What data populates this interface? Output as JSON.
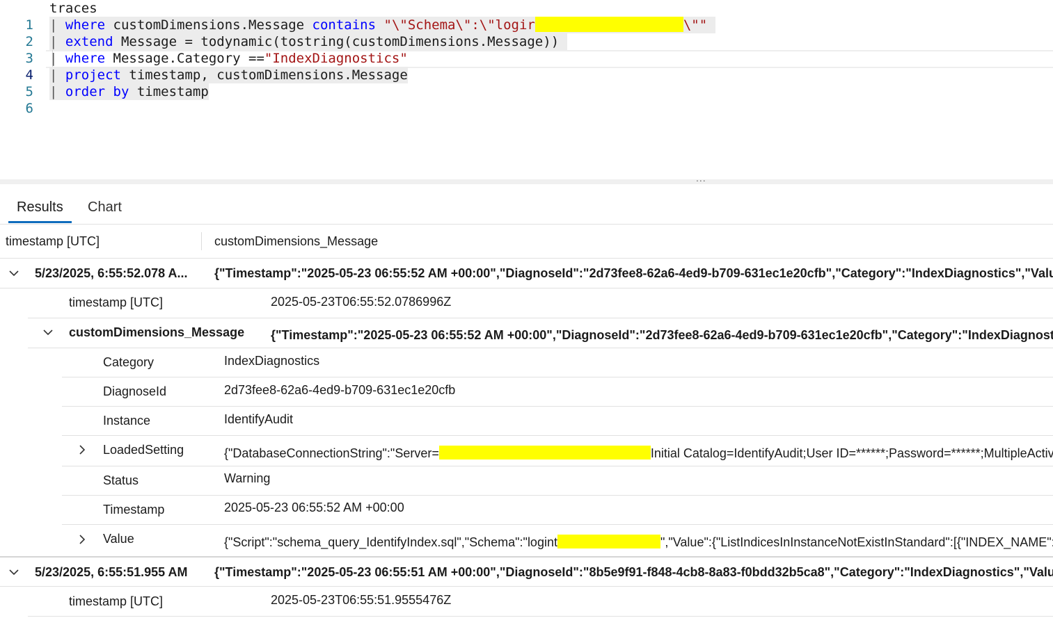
{
  "editor": {
    "lines": [
      {
        "num": "1",
        "text": "traces"
      },
      {
        "num": "2",
        "kw": "where",
        "t1": " customDimensions.Message ",
        "kw2": "contains",
        "str": "\"\\\"Schema\\\":\\\"logir",
        "str_end": "\\\"\""
      },
      {
        "num": "3",
        "kw": "extend",
        "t1": " Message = todynamic(tostring(customDimensions.Message))"
      },
      {
        "num": "4",
        "kw": "where",
        "t1": " Message.Category ==",
        "str": "\"IndexDiagnostics\""
      },
      {
        "num": "5",
        "kw": "project",
        "t1": " timestamp, customDimensions.Message"
      },
      {
        "num": "6",
        "kw": "order by",
        "t1": " timestamp"
      }
    ],
    "pipe": "|",
    "splitter_dots": "..."
  },
  "tabs": [
    {
      "label": "Results",
      "selected": true
    },
    {
      "label": "Chart",
      "selected": false
    }
  ],
  "grid": {
    "columns": [
      "timestamp [UTC]",
      "customDimensions_Message"
    ],
    "row1": {
      "timestamp": "5/23/2025, 6:55:52.078 A...",
      "message": "{\"Timestamp\":\"2025-05-23 06:55:52 AM +00:00\",\"DiagnoseId\":\"2d73fee8-62a6-4ed9-b709-631ec1e20cfb\",\"Category\":\"IndexDiagnostics\",\"Value\":{\"S",
      "detail_ts_label": "timestamp [UTC]",
      "detail_ts_value": "2025-05-23T06:55:52.0786996Z",
      "cd_label": "customDimensions_Message",
      "cd_value": "{\"Timestamp\":\"2025-05-23 06:55:52 AM +00:00\",\"DiagnoseId\":\"2d73fee8-62a6-4ed9-b709-631ec1e20cfb\",\"Category\":\"IndexDiagnostics\",\"",
      "props": [
        {
          "key": "Category",
          "value": "IndexDiagnostics"
        },
        {
          "key": "DiagnoseId",
          "value": "2d73fee8-62a6-4ed9-b709-631ec1e20cfb"
        },
        {
          "key": "Instance",
          "value": "IdentifyAudit"
        },
        {
          "key": "LoadedSetting",
          "value_a": "{\"DatabaseConnectionString\":\"Server=",
          "value_b": "Initial Catalog=IdentifyAudit;User ID=******;Password=******;MultipleActiv"
        },
        {
          "key": "Status",
          "value": "Warning"
        },
        {
          "key": "Timestamp",
          "value": "2025-05-23 06:55:52 AM +00:00"
        },
        {
          "key": "Value",
          "value_a": "{\"Script\":\"schema_query_IdentifyIndex.sql\",\"Schema\":\"logint",
          "value_b": "\",\"Value\":{\"ListIndicesInInstanceNotExistInStandard\":[{\"INDEX_NAME\":\"Idx_"
        }
      ]
    },
    "row2": {
      "timestamp": "5/23/2025, 6:55:51.955 AM",
      "message": "{\"Timestamp\":\"2025-05-23 06:55:51 AM +00:00\",\"DiagnoseId\":\"8b5e9f91-f848-4cb8-8a83-f0bdd32b5ca8\",\"Category\":\"IndexDiagnostics\",\"Value\":{\"S",
      "detail_ts_label": "timestamp [UTC]",
      "detail_ts_value": "2025-05-23T06:55:51.9555476Z"
    }
  },
  "colors": {
    "keyword": "#0000ff",
    "string": "#a31515",
    "line_number": "#237893",
    "redaction": "#ffff00",
    "tab_accent": "#0f6cbd"
  }
}
